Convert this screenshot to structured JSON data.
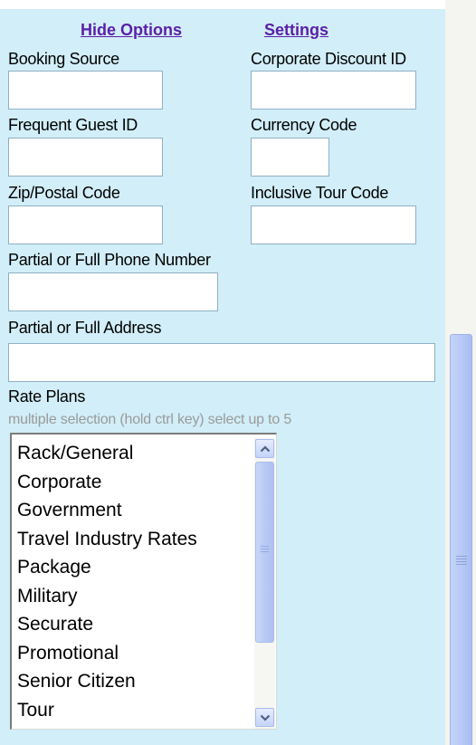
{
  "links": {
    "hide_options": "Hide Options",
    "settings": "Settings"
  },
  "fields": {
    "booking_source": {
      "label": "Booking Source",
      "value": ""
    },
    "corporate_discount_id": {
      "label": "Corporate Discount ID",
      "value": ""
    },
    "frequent_guest_id": {
      "label": "Frequent Guest ID",
      "value": ""
    },
    "currency_code": {
      "label": "Currency Code",
      "value": ""
    },
    "zip_postal_code": {
      "label": "Zip/Postal Code",
      "value": ""
    },
    "inclusive_tour_code": {
      "label": "Inclusive Tour Code",
      "value": ""
    },
    "phone_number": {
      "label": "Partial or Full Phone Number",
      "value": ""
    },
    "address": {
      "label": "Partial or Full Address",
      "value": ""
    }
  },
  "rate_plans": {
    "label": "Rate Plans",
    "hint": "multiple selection (hold ctrl key) select up to 5",
    "options": [
      "Rack/General",
      "Corporate",
      "Government",
      "Travel Industry Rates",
      "Package",
      "Military",
      "Securate",
      "Promotional",
      "Senior Citizen",
      "Tour"
    ]
  },
  "colors": {
    "panel_background": "#d2eef8",
    "link_color": "#5b1fa8",
    "hint_color": "#9a9a9a",
    "scrollbar_thumb": "#b7c9f6"
  },
  "icons": {
    "list_scroll_up": "chevron-up-icon",
    "list_scroll_down": "chevron-down-icon",
    "scroll_grip": "grip-icon"
  }
}
